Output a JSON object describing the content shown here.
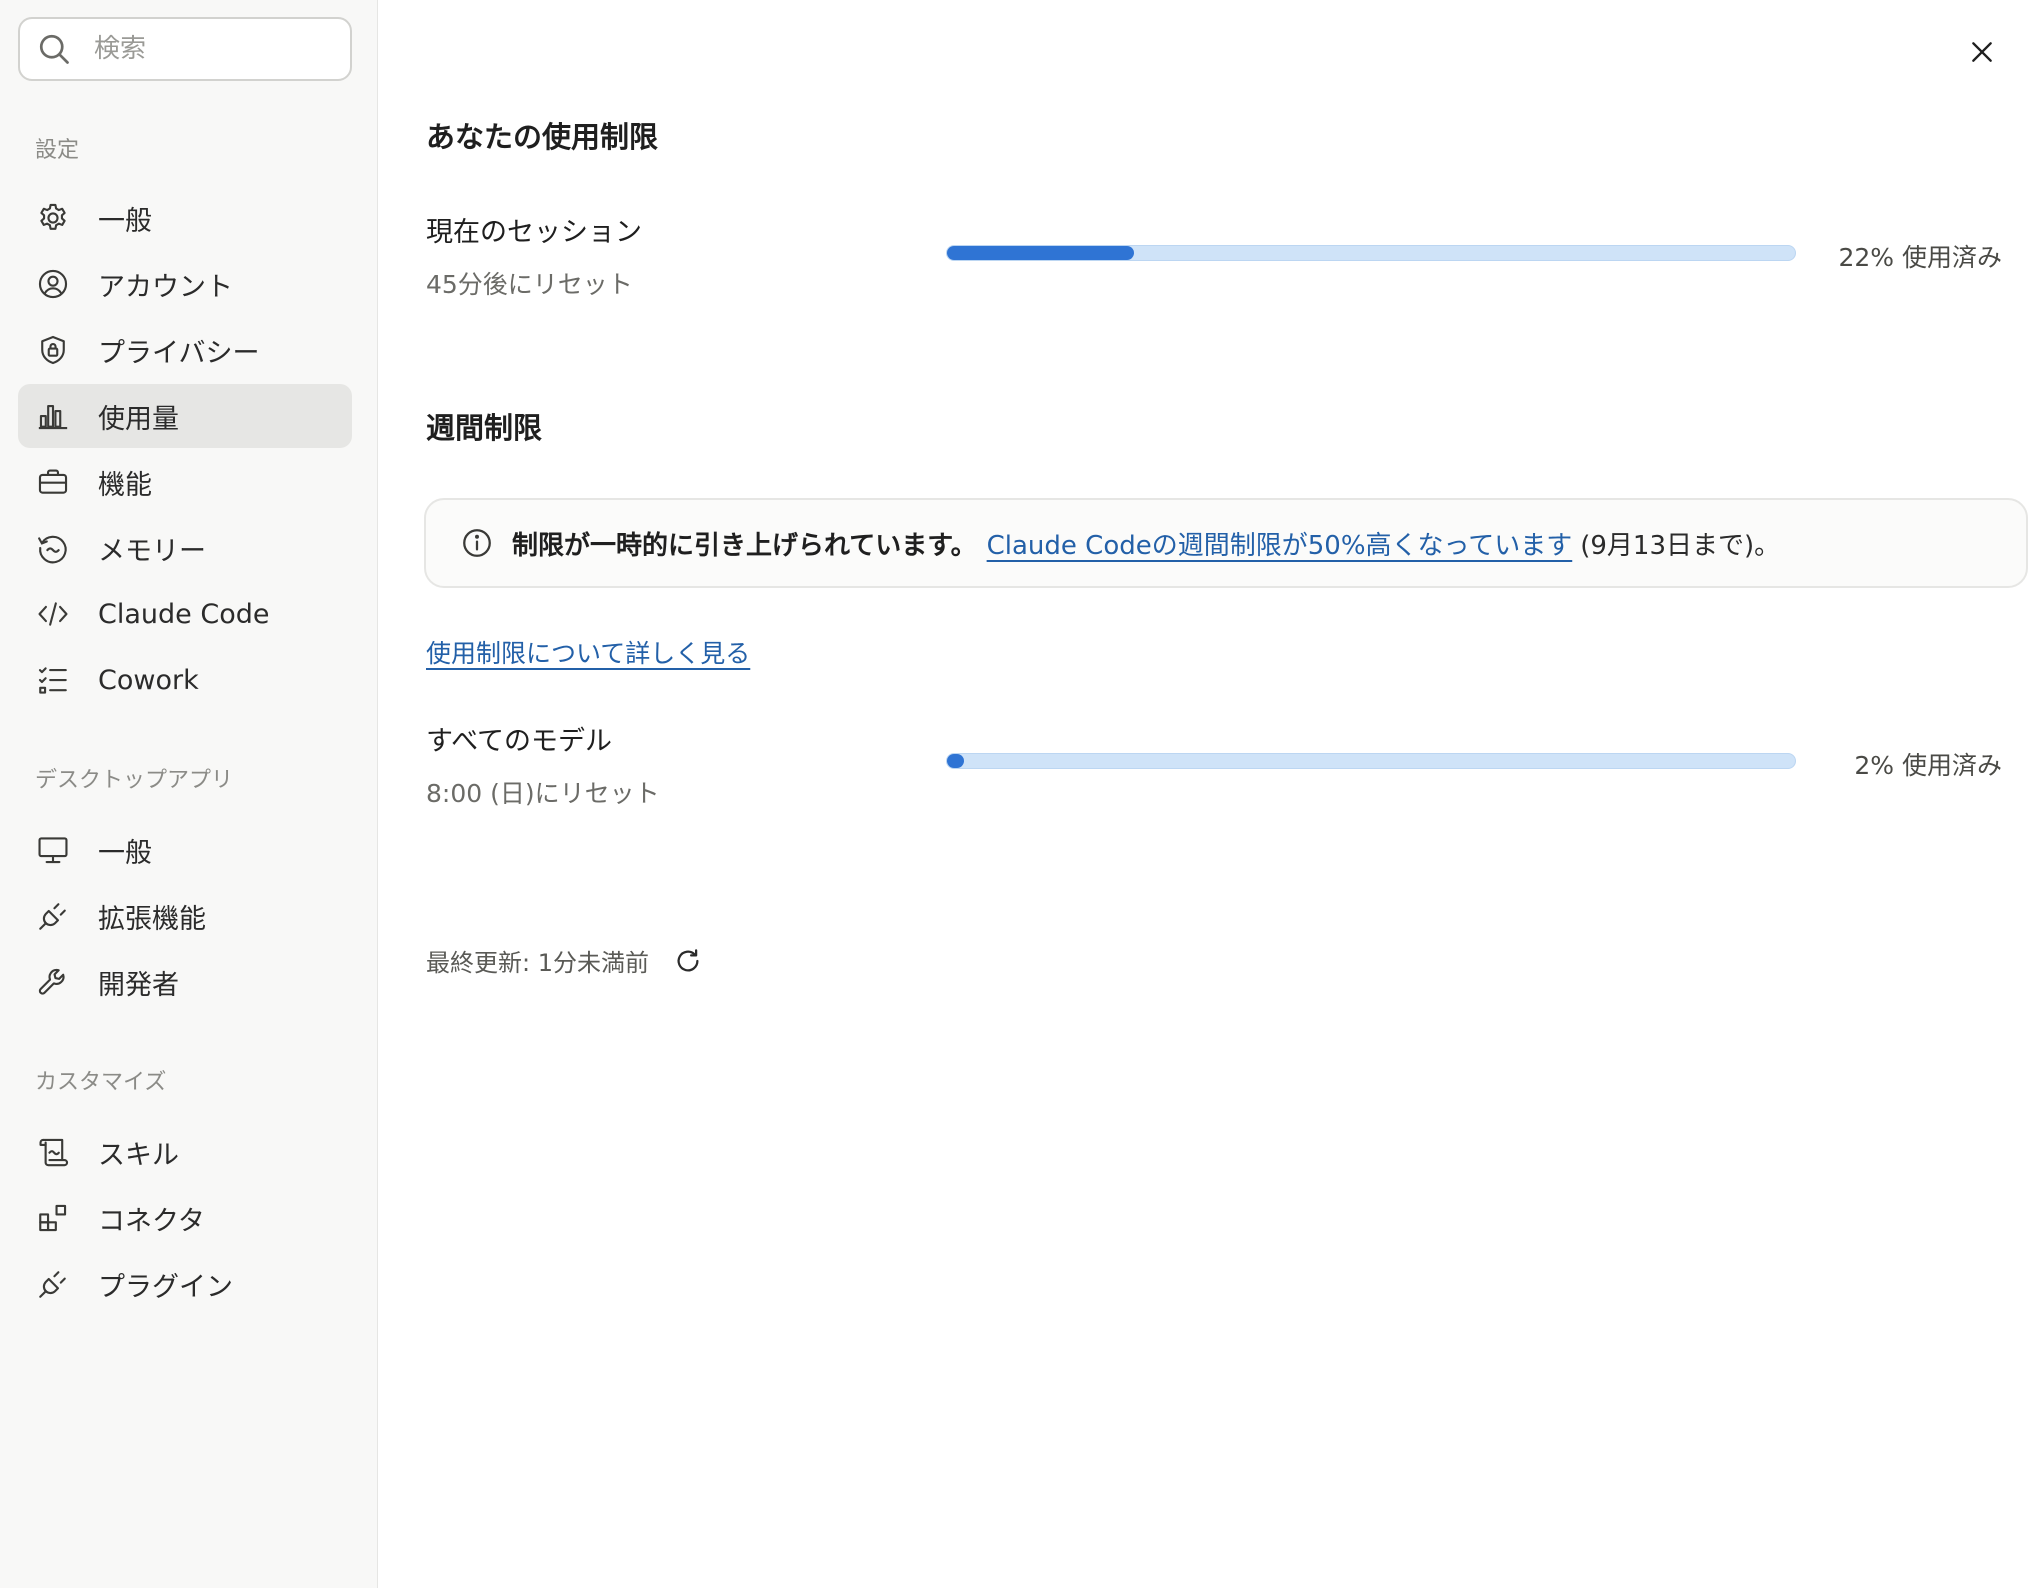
{
  "sidebar": {
    "search_placeholder": "検索",
    "sections": [
      {
        "label": "設定",
        "items": [
          {
            "label": "一般",
            "icon": "gear-icon"
          },
          {
            "label": "アカウント",
            "icon": "user-circle-icon"
          },
          {
            "label": "プライバシー",
            "icon": "shield-lock-icon"
          },
          {
            "label": "使用量",
            "icon": "bar-chart-icon",
            "active": true
          },
          {
            "label": "機能",
            "icon": "briefcase-icon"
          },
          {
            "label": "メモリー",
            "icon": "memory-icon"
          },
          {
            "label": "Claude Code",
            "icon": "code-icon"
          },
          {
            "label": "Cowork",
            "icon": "checklist-icon"
          }
        ]
      },
      {
        "label": "デスクトップアプリ",
        "items": [
          {
            "label": "一般",
            "icon": "monitor-icon"
          },
          {
            "label": "拡張機能",
            "icon": "plug-icon"
          },
          {
            "label": "開発者",
            "icon": "wrench-icon"
          }
        ]
      },
      {
        "label": "カスタマイズ",
        "items": [
          {
            "label": "スキル",
            "icon": "scroll-icon"
          },
          {
            "label": "コネクタ",
            "icon": "blocks-icon"
          },
          {
            "label": "プラグイン",
            "icon": "plug-icon"
          }
        ]
      }
    ]
  },
  "main": {
    "title": "あなたの使用制限",
    "session": {
      "title": "現在のセッション",
      "reset": "45分後にリセット",
      "percent": 22,
      "percent_label": "22% 使用済み"
    },
    "weekly": {
      "title": "週間制限",
      "notice": {
        "strong": "制限が一時的に引き上げられています。",
        "link": "Claude Codeの週間制限が50%高くなっています",
        "tail": "(9月13日まで)。"
      },
      "learn_more": "使用制限について詳しく見る",
      "all_models": {
        "title": "すべてのモデル",
        "reset": "8:00 (日)にリセット",
        "percent": 2,
        "percent_label": "2% 使用済み"
      }
    },
    "last_updated": "最終更新: 1分未満前"
  },
  "colors": {
    "accent": "#2f74d4",
    "bar_track": "#cfe3f8",
    "link": "#2360a8",
    "sidebar_bg": "#f8f8f7",
    "active_bg": "#e6e6e4"
  }
}
